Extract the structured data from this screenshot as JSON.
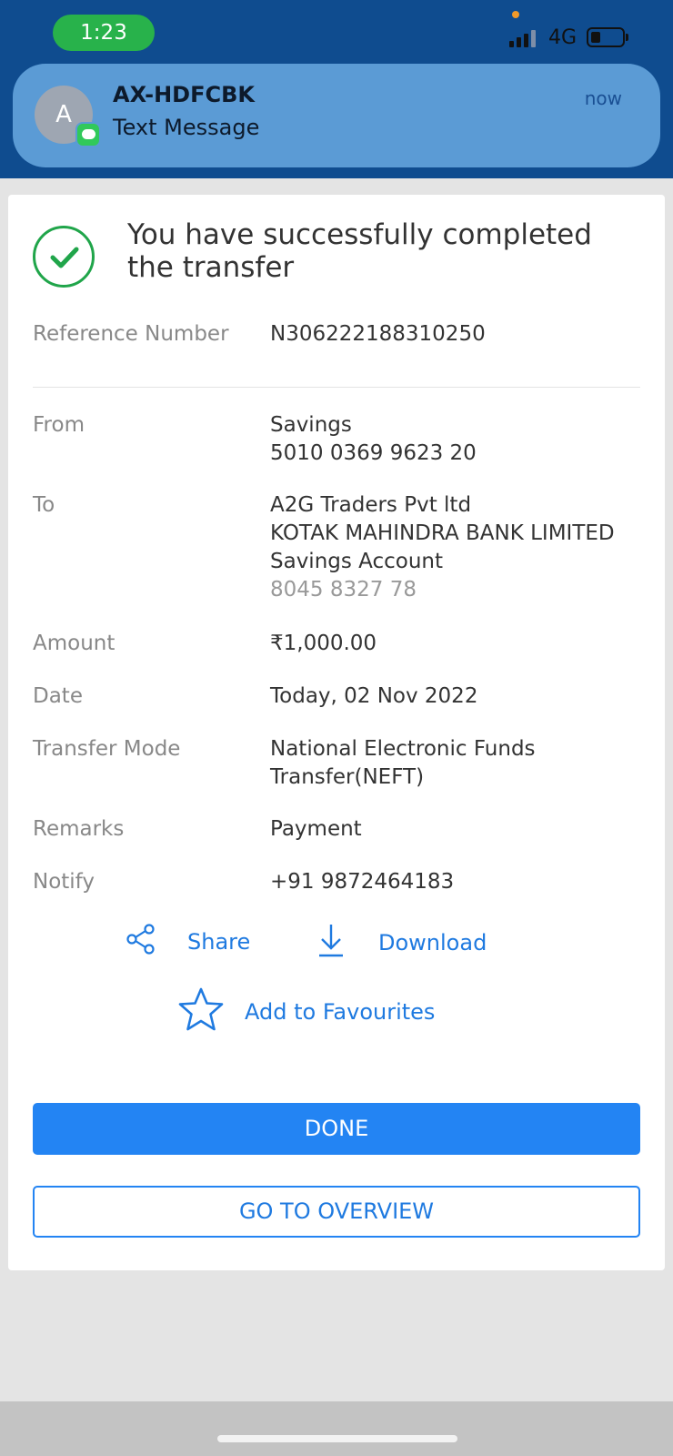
{
  "status_bar": {
    "time": "1:23",
    "network": "4G",
    "signal_bars_active": 3,
    "signal_bars_total": 4,
    "battery_level": 0.3
  },
  "notification": {
    "avatar_letter": "A",
    "sender": "AX-HDFCBK",
    "body": "Text Message",
    "time": "now",
    "app_icon": "messages-icon"
  },
  "receipt": {
    "success_message": "You have successfully completed the transfer",
    "success_icon": "check-circle-icon",
    "reference": {
      "label": "Reference Number",
      "value": "N306222188310250"
    },
    "from": {
      "label": "From",
      "account_type": "Savings",
      "account_number": "5010 0369 9623 20"
    },
    "to": {
      "label": "To",
      "name": "A2G Traders Pvt ltd",
      "bank": "KOTAK MAHINDRA BANK LIMITED",
      "account_type": "Savings Account",
      "account_number": "8045 8327 78"
    },
    "amount": {
      "label": "Amount",
      "value": "₹1,000.00"
    },
    "date": {
      "label": "Date",
      "value": "Today, 02 Nov 2022"
    },
    "transfer_mode": {
      "label": "Transfer Mode",
      "value_line1": "National Electronic Funds",
      "value_line2": "Transfer(NEFT)"
    },
    "remarks": {
      "label": "Remarks",
      "value": "Payment"
    },
    "notify": {
      "label": "Notify",
      "value": "+91 9872464183"
    }
  },
  "actions": {
    "share": {
      "label": "Share",
      "icon": "share-icon"
    },
    "download": {
      "label": "Download",
      "icon": "download-icon"
    },
    "favourites": {
      "label": "Add to Favourites",
      "icon": "star-icon"
    }
  },
  "buttons": {
    "done": "DONE",
    "overview": "GO TO OVERVIEW"
  },
  "colors": {
    "header_bg": "#0f4c8f",
    "notification_bg": "#5b9bd5",
    "accent": "#2384f3",
    "success": "#20a54a",
    "time_pill": "#28b24b"
  }
}
